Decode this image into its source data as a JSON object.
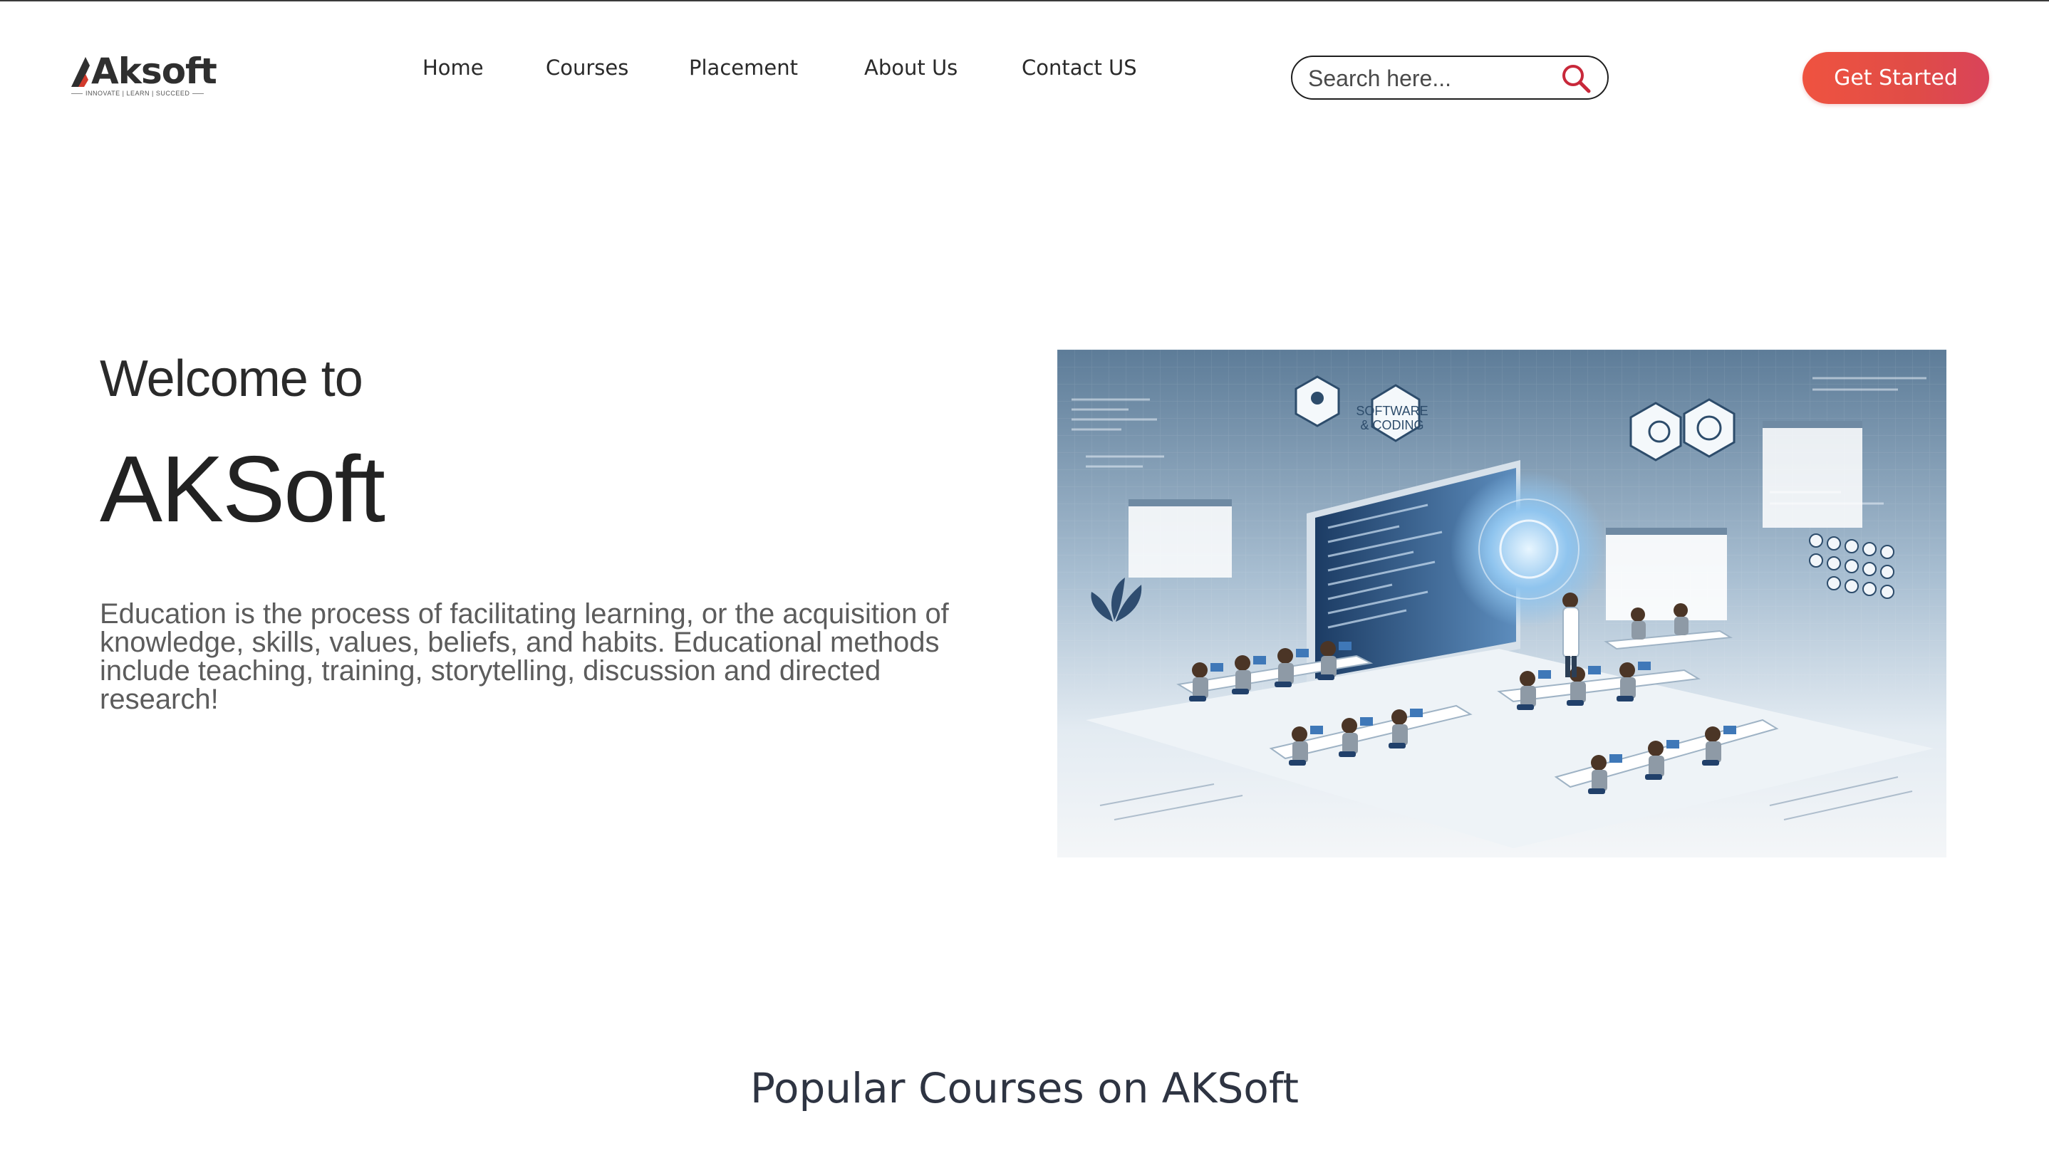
{
  "header": {
    "logo": {
      "name": "Aksoft",
      "tagline": "INNOVATE | LEARN | SUCCEED"
    },
    "nav": [
      "Home",
      "Courses",
      "Placement",
      "About Us",
      "Contact US"
    ],
    "search": {
      "placeholder": "Search here...",
      "icon": "search-icon"
    },
    "cta_label": "Get Started"
  },
  "hero": {
    "pre_title": "Welcome to",
    "title": "AKSoft",
    "description": "Education is the process of facilitating learning, or the acquisition of knowledge, skills, values, beliefs, and habits. Educational methods include teaching, training, storytelling, discussion and directed research!",
    "image": {
      "labels": [
        "SOFTWARE",
        "& CODING"
      ]
    }
  },
  "courses_section": {
    "title": "Popular Courses on AKSoft"
  },
  "colors": {
    "accent_start": "#ef5340",
    "accent_end": "#d9435a",
    "search_icon": "#c8283a",
    "logo_mark": "#d23a2c"
  }
}
